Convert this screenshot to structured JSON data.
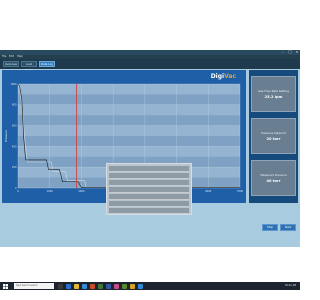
{
  "window": {
    "title": "",
    "controls": [
      "–",
      "□",
      "×"
    ]
  },
  "menu": {
    "items": [
      "File",
      "Edit",
      "Help"
    ]
  },
  "tabs": [
    {
      "label": "Overview",
      "active": false
    },
    {
      "label": "Load Profile",
      "active": false
    },
    {
      "label": "Data Log",
      "active": true
    }
  ],
  "brand": {
    "prefix": "Digi",
    "suffix": "Vac"
  },
  "chart_data": {
    "type": "line",
    "xlabel": "Time (seconds)",
    "ylabel": "Pressure",
    "x_ticks": [
      "0",
      "1000",
      "2000",
      "3000",
      "4000",
      "5000",
      "6000",
      "7000"
    ],
    "y_ticks": [
      "1000",
      "800",
      "600",
      "400",
      "200",
      "0"
    ],
    "xlim": [
      0,
      7000
    ],
    "ylim": [
      0,
      1000
    ],
    "grid": true,
    "cursor_x": 1850,
    "series": [
      {
        "color": "#1a1a1a",
        "x": [
          0,
          50,
          120,
          180,
          240,
          900,
          960,
          1000,
          1300,
          1360,
          1400,
          1900,
          1950,
          2000,
          7000
        ],
        "y": [
          1000,
          980,
          850,
          480,
          270,
          270,
          180,
          180,
          180,
          120,
          60,
          60,
          30,
          5,
          5
        ]
      },
      {
        "color": "#cfd8e0",
        "x": [
          0,
          60,
          150,
          240,
          300,
          1050,
          1100,
          1500,
          1560,
          2100,
          2150,
          7000
        ],
        "y": [
          1000,
          950,
          700,
          380,
          250,
          250,
          160,
          160,
          70,
          70,
          3,
          3
        ]
      }
    ]
  },
  "readouts": [
    {
      "label": "Gas Flow Rate Setting",
      "value": "25.2 lpm"
    },
    {
      "label": "Pressure Setpoint",
      "value": "20 torr"
    },
    {
      "label": "Measured Pressure",
      "value": "40 torr"
    }
  ],
  "table": {
    "rows": [
      [
        "",
        "",
        ""
      ],
      [
        "",
        "",
        ""
      ],
      [
        "",
        "",
        ""
      ],
      [
        "",
        "",
        ""
      ],
      [
        "",
        "",
        ""
      ],
      [
        "",
        "",
        ""
      ],
      [
        "",
        "",
        ""
      ]
    ]
  },
  "buttons": {
    "left": "Stop",
    "right": "Start"
  },
  "taskbar": {
    "search_placeholder": "Type here to search",
    "clock": "10:41 AM"
  },
  "colors": {
    "panel": "#1f5fa8",
    "cursor": "#e0302a",
    "app_bg": "#a8cbe0"
  }
}
